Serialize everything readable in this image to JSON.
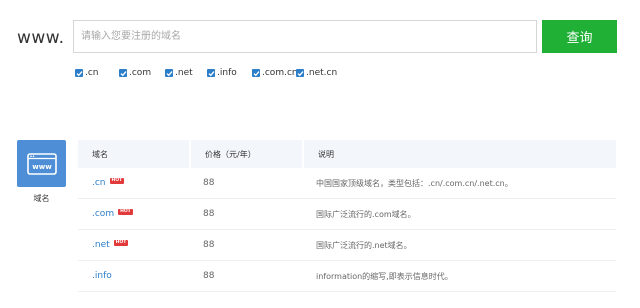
{
  "search": {
    "prefix": "www.",
    "placeholder": "请输入您要注册的域名",
    "button_label": "查询"
  },
  "tld_options": [
    {
      "label": ".cn",
      "checked": true
    },
    {
      "label": ".com",
      "checked": true
    },
    {
      "label": ".net",
      "checked": true
    },
    {
      "label": ".info",
      "checked": true
    },
    {
      "label": ".com.cn",
      "checked": true
    },
    {
      "label": ".net.cn",
      "checked": true
    }
  ],
  "category": {
    "icon_text": "www",
    "label": "域名"
  },
  "table": {
    "headers": [
      "域名",
      "价格（元/年）",
      "说明"
    ],
    "hot_label": "HOT",
    "rows": [
      {
        "tld": ".cn",
        "hot": true,
        "price": "88",
        "desc": "中国国家顶级域名，类型包括：.cn/.com.cn/.net.cn。"
      },
      {
        "tld": ".com",
        "hot": true,
        "price": "88",
        "desc": "国际广泛流行的.com域名。"
      },
      {
        "tld": ".net",
        "hot": true,
        "price": "88",
        "desc": "国际广泛流行的.net域名。"
      },
      {
        "tld": ".info",
        "hot": false,
        "price": "88",
        "desc": "information的缩写,即表示信息时代。"
      }
    ]
  },
  "colors": {
    "accent_blue": "#2d7ec9",
    "button_green": "#1fb035",
    "hot_red": "#e23a3a",
    "icon_blue": "#4d8ed6"
  }
}
